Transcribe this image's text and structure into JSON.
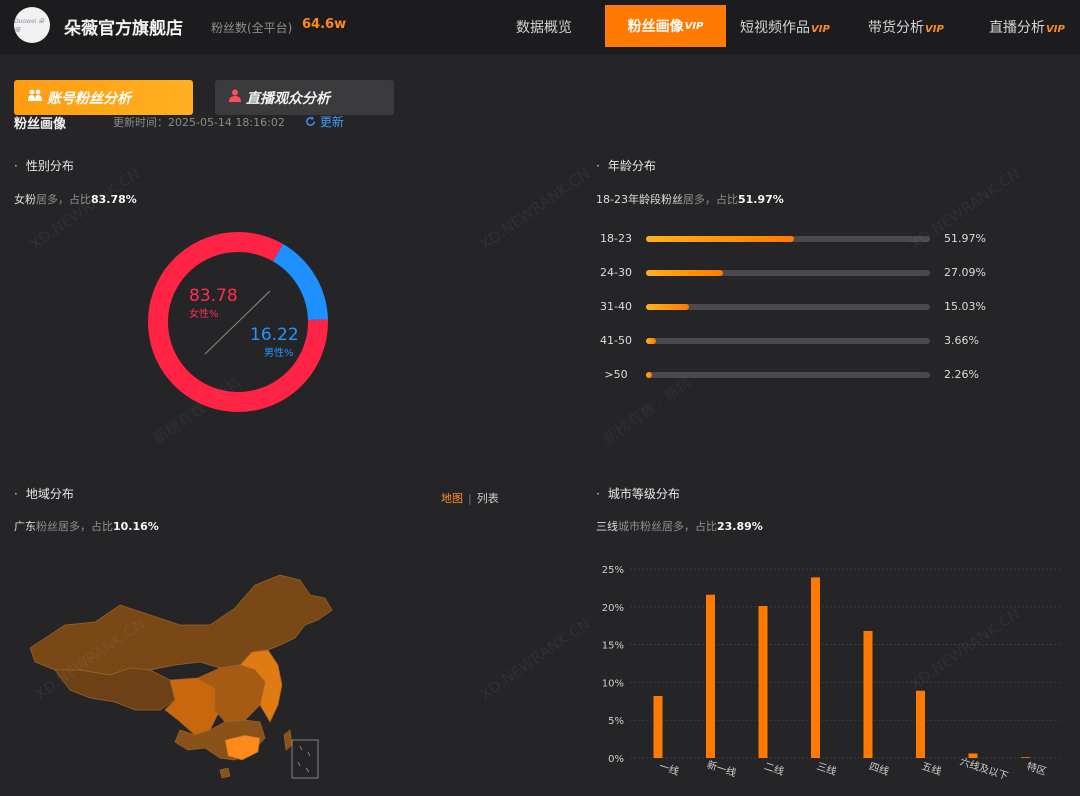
{
  "header": {
    "logo_text": "Duowei 朵薇",
    "shop_name": "朵薇官方旗舰店",
    "fans_label": "粉丝数(全平台)",
    "fans_value": "64.6w",
    "nav": [
      {
        "label": "数据概览",
        "vip": ""
      },
      {
        "label": "粉丝画像",
        "vip": "VIP"
      },
      {
        "label": "短视频作品",
        "vip": "VIP"
      },
      {
        "label": "带货分析",
        "vip": "VIP"
      },
      {
        "label": "直播分析",
        "vip": "VIP"
      }
    ]
  },
  "subtabs": [
    {
      "label": "账号粉丝分析",
      "icon": "people-icon"
    },
    {
      "label": "直播观众分析",
      "icon": "user-icon"
    }
  ],
  "section": {
    "title": "粉丝画像",
    "update_time": "更新时间：2025-05-14 18:16:02",
    "refresh_label": "更新"
  },
  "gender": {
    "title": "性别分布",
    "summary_lead": "女粉",
    "summary_mid": "居多，占比",
    "summary_value": "83.78%",
    "female_value": "83.78",
    "female_label": "女性%",
    "male_value": "16.22",
    "male_label": "男性%",
    "female_pct": 83.78,
    "male_pct": 16.22,
    "colors": {
      "female": "#ff2445",
      "male": "#1e90ff"
    }
  },
  "age": {
    "title": "年龄分布",
    "summary_lead": "18-23年龄段粉丝",
    "summary_mid": "居多，占比",
    "summary_value": "51.97%",
    "rows": [
      {
        "label": "18-23",
        "value": "51.97%",
        "pct": 51.97
      },
      {
        "label": "24-30",
        "value": "27.09%",
        "pct": 27.09
      },
      {
        "label": "31-40",
        "value": "15.03%",
        "pct": 15.03
      },
      {
        "label": "41-50",
        "value": "3.66%",
        "pct": 3.66
      },
      {
        "label": ">50",
        "value": "2.26%",
        "pct": 2.26
      }
    ]
  },
  "region": {
    "title": "地域分布",
    "summary_lead": "广东",
    "summary_mid": "粉丝居多，占比",
    "summary_value": "10.16%",
    "toggle_map": "地图",
    "toggle_list": "列表"
  },
  "city": {
    "title": "城市等级分布",
    "summary_lead": "三线",
    "summary_mid": "城市粉丝居多，占比",
    "summary_value": "23.89%"
  },
  "chart_data": {
    "type": "bar",
    "categories": [
      "一线",
      "新一线",
      "二线",
      "三线",
      "四线",
      "五线",
      "六线及以下",
      "特区"
    ],
    "values": [
      8.2,
      21.6,
      20.1,
      23.89,
      16.8,
      8.9,
      0.6,
      0.1
    ],
    "y_ticks": [
      "0%",
      "5%",
      "10%",
      "15%",
      "20%",
      "25%"
    ],
    "ylim": [
      0,
      25
    ],
    "color": "#ff7a00"
  },
  "watermarks": [
    "XD.NEWRANK.CN",
    "新榜有数 · 新抖"
  ]
}
